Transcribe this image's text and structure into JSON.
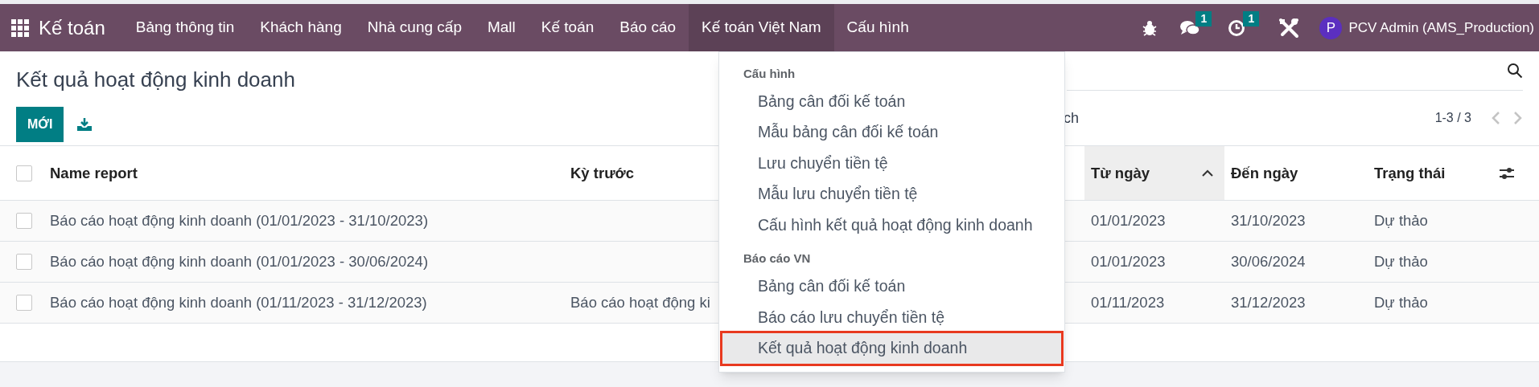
{
  "navbar": {
    "app_name": "Kế toán",
    "menu": [
      {
        "label": "Bảng thông tin",
        "selected": false
      },
      {
        "label": "Khách hàng",
        "selected": false
      },
      {
        "label": "Nhà cung cấp",
        "selected": false
      },
      {
        "label": "Mall",
        "selected": false
      },
      {
        "label": "Kế toán",
        "selected": false
      },
      {
        "label": "Báo cáo",
        "selected": false
      },
      {
        "label": "Kế toán Việt Nam",
        "selected": true
      },
      {
        "label": "Cấu hình",
        "selected": false
      }
    ],
    "chat_badge": "1",
    "activity_badge": "1",
    "user": {
      "initial": "P",
      "name": "PCV Admin (AMS_Production)"
    }
  },
  "page": {
    "title": "Kết quả hoạt động kinh doanh",
    "new_button": "MỚI",
    "partial_text": "ch",
    "pager": "1-3 / 3"
  },
  "table": {
    "columns": [
      {
        "label": "Name report",
        "sorted": false
      },
      {
        "label": "Kỳ trước",
        "sorted": false
      },
      {
        "label": "Từ ngày",
        "sorted": true
      },
      {
        "label": "Đến ngày",
        "sorted": false
      },
      {
        "label": "Trạng thái",
        "sorted": false
      }
    ],
    "select_all": {
      "checked": false
    },
    "rows": [
      {
        "checked": false,
        "cells": [
          "Báo cáo hoạt động kinh doanh (01/01/2023 - 31/10/2023)",
          "",
          "01/01/2023",
          "31/10/2023",
          "Dự thảo"
        ]
      },
      {
        "checked": false,
        "cells": [
          "Báo cáo hoạt động kinh doanh (01/01/2023 - 30/06/2024)",
          "",
          "01/01/2023",
          "30/06/2024",
          "Dự thảo"
        ]
      },
      {
        "checked": false,
        "cells": [
          "Báo cáo hoạt động kinh doanh (01/11/2023 - 31/12/2023)",
          "Báo cáo hoạt động ki",
          "01/11/2023",
          "31/12/2023",
          "Dự thảo"
        ]
      }
    ]
  },
  "dropdown": {
    "sections": [
      {
        "title": "Cấu hình",
        "items": [
          {
            "label": "Bảng cân đối kế toán",
            "selected": false
          },
          {
            "label": "Mẫu bảng cân đối kế toán",
            "selected": false
          },
          {
            "label": "Lưu chuyển tiền tệ",
            "selected": false
          },
          {
            "label": "Mẫu lưu chuyển tiền tệ",
            "selected": false
          },
          {
            "label": "Cấu hình kết quả hoạt động kinh doanh",
            "selected": false
          }
        ]
      },
      {
        "title": "Báo cáo VN",
        "items": [
          {
            "label": "Bảng cân đối kế toán",
            "selected": false
          },
          {
            "label": "Báo cáo lưu chuyển tiền tệ",
            "selected": false
          },
          {
            "label": "Kết quả hoạt động kinh doanh",
            "selected": true
          }
        ]
      }
    ]
  }
}
